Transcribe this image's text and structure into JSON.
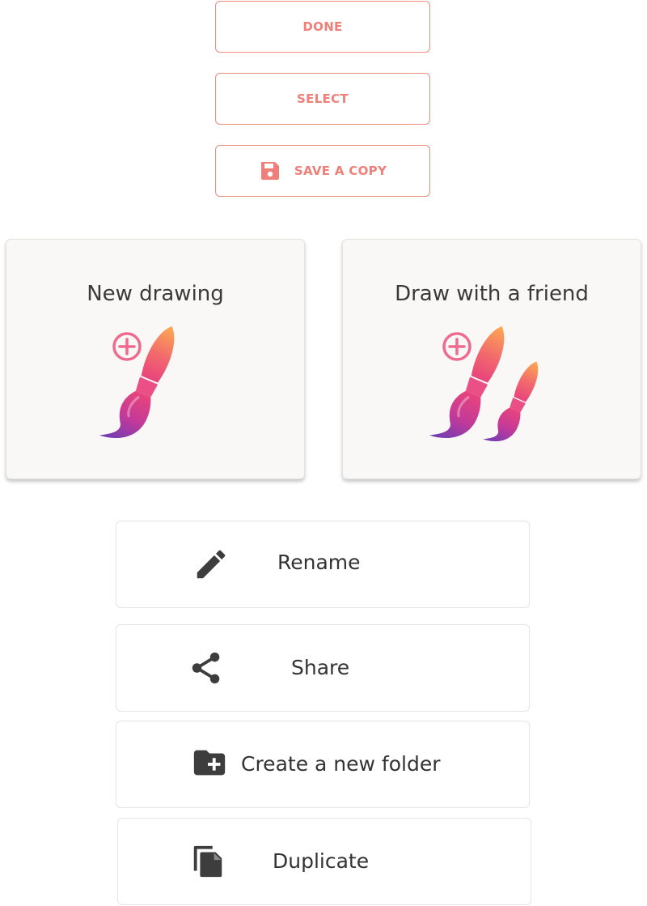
{
  "toolbar": {
    "done_label": "DONE",
    "select_label": "SELECT",
    "save_copy_label": "SAVE A COPY",
    "save_copy_icon": "floppy-disk-icon"
  },
  "cards": {
    "new_drawing": {
      "title": "New drawing",
      "icon": "paintbrush-plus-icon"
    },
    "draw_with_friend": {
      "title": "Draw with a friend",
      "icon": "two-paintbrushes-plus-icon"
    }
  },
  "actions": {
    "rename": {
      "label": "Rename",
      "icon": "pencil-icon"
    },
    "share": {
      "label": "Share",
      "icon": "share-icon"
    },
    "new_folder": {
      "label": "Create a new folder",
      "icon": "folder-plus-icon"
    },
    "duplicate": {
      "label": "Duplicate",
      "icon": "copy-icon"
    }
  },
  "colors": {
    "accent": "#ef7f78",
    "brush_gradient_top": "#fb9d52",
    "brush_gradient_mid": "#e8417f",
    "brush_gradient_bottom": "#6e3db6",
    "plus_circle": "#ef6a8e",
    "icon_dark": "#3d3d3d"
  }
}
